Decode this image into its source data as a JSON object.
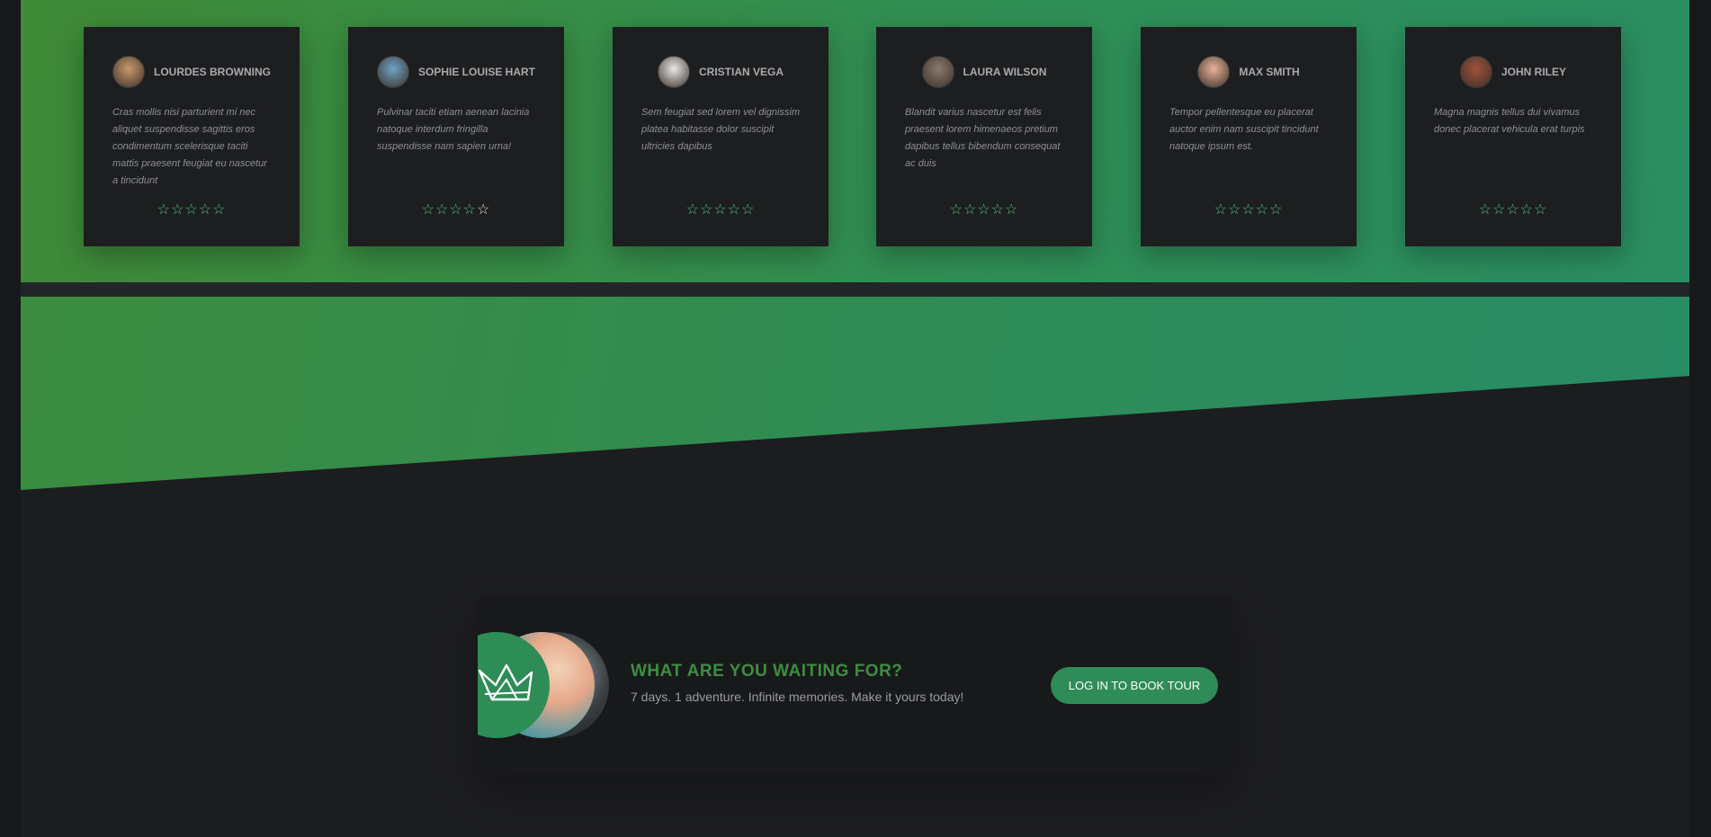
{
  "testimonials": [
    {
      "name": "LOURDES BROWNING",
      "text": "Cras mollis nisi parturient mi nec aliquet suspendisse sagittis eros condimentum scelerisque taciti mattis praesent feugiat eu nascetur a tincidunt",
      "rating": 5,
      "avatar_color": "#c79a6c"
    },
    {
      "name": "SOPHIE LOUISE HART",
      "text": "Pulvinar taciti etiam aenean lacinia natoque interdum fringilla suspendisse nam sapien urna!",
      "rating": 4,
      "avatar_color": "#6fa3c7"
    },
    {
      "name": "CRISTIAN VEGA",
      "text": "Sem feugiat sed lorem vel dignissim platea habitasse dolor suscipit ultricies dapibus",
      "rating": 5,
      "avatar_color": "#e9e9e9"
    },
    {
      "name": "LAURA WILSON",
      "text": "Blandit varius nascetur est felis praesent lorem himenaeos pretium dapibus tellus bibendum consequat ac duis",
      "rating": 5,
      "avatar_color": "#8a7a70"
    },
    {
      "name": "MAX SMITH",
      "text": "Tempor pellentesque eu placerat auctor enim nam suscipit tincidunt natoque ipsum est.",
      "rating": 5,
      "avatar_color": "#e8b29a"
    },
    {
      "name": "JOHN RILEY",
      "text": "Magna magnis tellus dui vivamus donec placerat vehicula erat turpis",
      "rating": 5,
      "avatar_color": "#a0523d"
    }
  ],
  "cta": {
    "title": "WHAT ARE YOU WAITING FOR?",
    "subtitle": "7 days. 1 adventure. Infinite memories. Make it yours today!",
    "button_label": "LOG IN TO BOOK TOUR"
  },
  "colors": {
    "accent": "#2e8c58",
    "star": "#4ec27c",
    "title_green": "#3d8e3f"
  },
  "icons": {
    "star": "star-icon",
    "logo": "crown-logo-icon"
  }
}
